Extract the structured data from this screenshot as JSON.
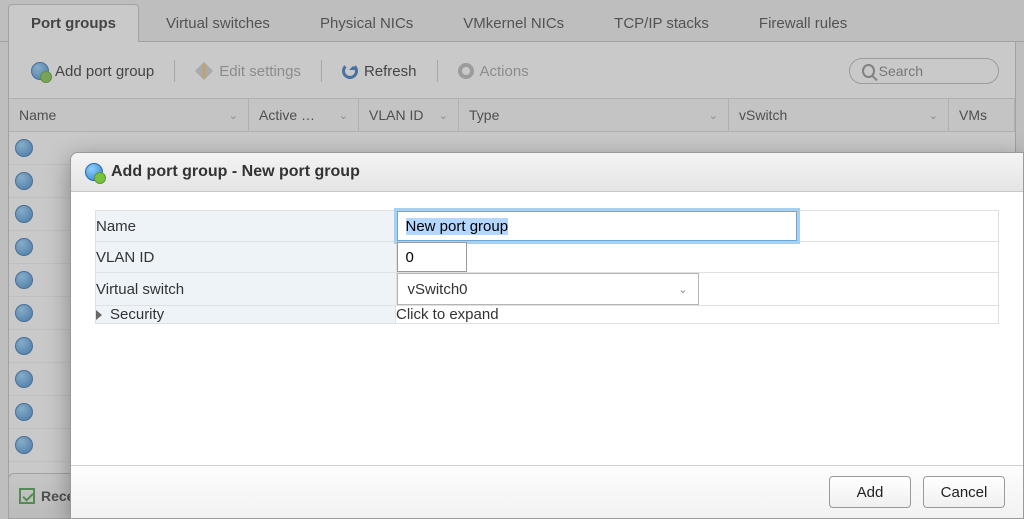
{
  "tabs": {
    "t0": "Port groups",
    "t1": "Virtual switches",
    "t2": "Physical NICs",
    "t3": "VMkernel NICs",
    "t4": "TCP/IP stacks",
    "t5": "Firewall rules"
  },
  "toolbar": {
    "add": "Add port group",
    "edit": "Edit settings",
    "refresh": "Refresh",
    "actions": "Actions",
    "search_placeholder": "Search"
  },
  "columns": {
    "name": "Name",
    "active": "Active …",
    "vlan": "VLAN ID",
    "type": "Type",
    "vswitch": "vSwitch",
    "vms": "VMs"
  },
  "footer": {
    "label": "Rece"
  },
  "modal": {
    "title": "Add port group - New port group",
    "fields": {
      "name_label": "Name",
      "name_value": "New port group",
      "vlan_label": "VLAN ID",
      "vlan_value": "0",
      "vswitch_label": "Virtual switch",
      "vswitch_value": "vSwitch0",
      "security_label": "Security",
      "security_hint": "Click to expand"
    },
    "buttons": {
      "ok": "Add",
      "cancel": "Cancel"
    }
  }
}
